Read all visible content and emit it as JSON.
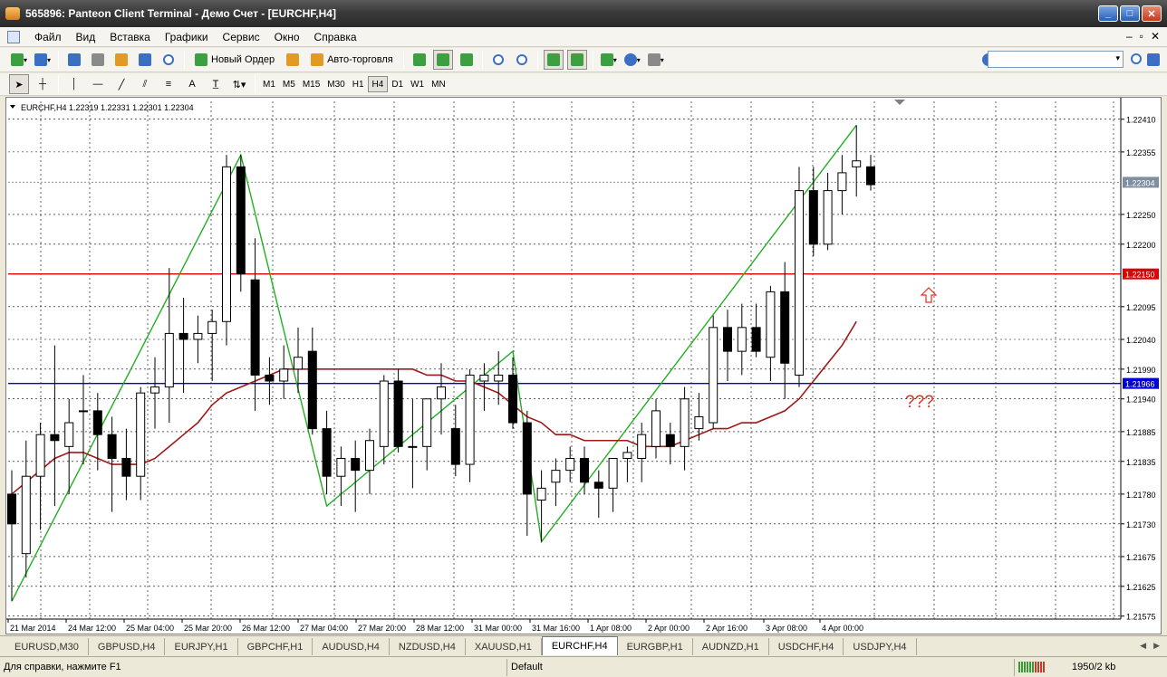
{
  "window": {
    "title": "565896: Panteon Client Terminal - Демо Счет - [EURCHF,H4]"
  },
  "menu": [
    "Файл",
    "Вид",
    "Вставка",
    "Графики",
    "Сервис",
    "Окно",
    "Справка"
  ],
  "toolbar": {
    "new_order": "Новый Ордер",
    "autotrading": "Авто-торговля"
  },
  "timeframes": [
    "M1",
    "M5",
    "M15",
    "M30",
    "H1",
    "H4",
    "D1",
    "W1",
    "MN"
  ],
  "active_timeframe": "H4",
  "draw_tools": {
    "text_tool": "A"
  },
  "search": {
    "value": ""
  },
  "chart_info": "EURCHF,H4  1.22319 1.22331 1.22301 1.22304",
  "chart_data": {
    "type": "candlestick",
    "symbol": "EURCHF",
    "timeframe": "H4",
    "ylim": [
      1.2157,
      1.2244
    ],
    "yticks": [
      "1.22410",
      "1.22355",
      "1.22304",
      "1.22250",
      "1.22200",
      "1.22150",
      "1.22095",
      "1.22040",
      "1.21990",
      "1.21966",
      "1.21940",
      "1.21885",
      "1.21835",
      "1.21780",
      "1.21730",
      "1.21675",
      "1.21625",
      "1.21575"
    ],
    "xticks": [
      "21 Mar 2014",
      "24 Mar 12:00",
      "25 Mar 04:00",
      "25 Mar 20:00",
      "26 Mar 12:00",
      "27 Mar 04:00",
      "27 Mar 20:00",
      "28 Mar 12:00",
      "31 Mar 00:00",
      "31 Mar 16:00",
      "1 Apr 08:00",
      "2 Apr 00:00",
      "2 Apr 16:00",
      "3 Apr 08:00",
      "4 Apr 00:00"
    ],
    "candles": [
      [
        1.2178,
        1.2182,
        1.216,
        1.2173
      ],
      [
        1.2168,
        1.2187,
        1.2164,
        1.2181
      ],
      [
        1.2181,
        1.219,
        1.2172,
        1.2188
      ],
      [
        1.2188,
        1.2203,
        1.2176,
        1.2187
      ],
      [
        1.2186,
        1.2194,
        1.2178,
        1.219
      ],
      [
        1.2192,
        1.2198,
        1.2183,
        1.2192
      ],
      [
        1.2192,
        1.2195,
        1.2182,
        1.2188
      ],
      [
        1.2188,
        1.2191,
        1.2175,
        1.2184
      ],
      [
        1.2184,
        1.2189,
        1.2177,
        1.2181
      ],
      [
        1.2181,
        1.2196,
        1.2177,
        1.2195
      ],
      [
        1.2195,
        1.2201,
        1.2189,
        1.2196
      ],
      [
        1.2196,
        1.2216,
        1.219,
        1.2205
      ],
      [
        1.2205,
        1.2211,
        1.2195,
        1.2204
      ],
      [
        1.2204,
        1.2208,
        1.22,
        1.2205
      ],
      [
        1.2205,
        1.2209,
        1.2197,
        1.2207
      ],
      [
        1.2207,
        1.2235,
        1.2203,
        1.2233
      ],
      [
        1.2233,
        1.2235,
        1.2212,
        1.2215
      ],
      [
        1.2214,
        1.2221,
        1.2192,
        1.2198
      ],
      [
        1.2198,
        1.2201,
        1.2193,
        1.2197
      ],
      [
        1.2197,
        1.2203,
        1.2194,
        1.2199
      ],
      [
        1.2199,
        1.2206,
        1.2195,
        1.2201
      ],
      [
        1.2202,
        1.2206,
        1.2188,
        1.2189
      ],
      [
        1.2189,
        1.2192,
        1.2178,
        1.2181
      ],
      [
        1.2181,
        1.2186,
        1.2176,
        1.2184
      ],
      [
        1.2184,
        1.2187,
        1.2175,
        1.2182
      ],
      [
        1.2182,
        1.2189,
        1.2178,
        1.2187
      ],
      [
        1.2186,
        1.2198,
        1.2183,
        1.2197
      ],
      [
        1.2197,
        1.2199,
        1.2185,
        1.2186
      ],
      [
        1.2186,
        1.2194,
        1.2179,
        1.2186
      ],
      [
        1.2186,
        1.2194,
        1.2182,
        1.2194
      ],
      [
        1.2194,
        1.22,
        1.2188,
        1.2196
      ],
      [
        1.2189,
        1.2193,
        1.2181,
        1.2183
      ],
      [
        1.2183,
        1.2199,
        1.218,
        1.2198
      ],
      [
        1.2197,
        1.22,
        1.2192,
        1.2198
      ],
      [
        1.2197,
        1.2202,
        1.2193,
        1.2198
      ],
      [
        1.2198,
        1.2201,
        1.2189,
        1.219
      ],
      [
        1.219,
        1.2192,
        1.2171,
        1.2178
      ],
      [
        1.2177,
        1.2182,
        1.217,
        1.2179
      ],
      [
        1.218,
        1.2184,
        1.2176,
        1.2182
      ],
      [
        1.2182,
        1.2186,
        1.218,
        1.2184
      ],
      [
        1.2184,
        1.2186,
        1.2178,
        1.218
      ],
      [
        1.218,
        1.2182,
        1.2174,
        1.2179
      ],
      [
        1.2179,
        1.2184,
        1.2175,
        1.2184
      ],
      [
        1.2184,
        1.2186,
        1.218,
        1.2185
      ],
      [
        1.2184,
        1.219,
        1.218,
        1.2188
      ],
      [
        1.2186,
        1.2194,
        1.2184,
        1.2192
      ],
      [
        1.2188,
        1.219,
        1.2183,
        1.2186
      ],
      [
        1.2186,
        1.2196,
        1.2182,
        1.2194
      ],
      [
        1.2189,
        1.2195,
        1.2187,
        1.2191
      ],
      [
        1.219,
        1.2208,
        1.2189,
        1.2206
      ],
      [
        1.2206,
        1.2209,
        1.2197,
        1.2202
      ],
      [
        1.2202,
        1.221,
        1.2198,
        1.2206
      ],
      [
        1.2206,
        1.221,
        1.2201,
        1.2202
      ],
      [
        1.2201,
        1.2213,
        1.2197,
        1.2212
      ],
      [
        1.2212,
        1.2217,
        1.2194,
        1.22
      ],
      [
        1.2198,
        1.2233,
        1.2196,
        1.2229
      ],
      [
        1.2229,
        1.2233,
        1.2218,
        1.222
      ],
      [
        1.222,
        1.2232,
        1.2219,
        1.2229
      ],
      [
        1.2229,
        1.2235,
        1.2225,
        1.2232
      ],
      [
        1.2233,
        1.224,
        1.2228,
        1.2234
      ],
      [
        1.2233,
        1.2235,
        1.2229,
        1.223
      ]
    ],
    "moving_average": [
      1.2178,
      1.218,
      1.2182,
      1.2184,
      1.2185,
      1.2185,
      1.2184,
      1.2183,
      1.2183,
      1.2183,
      1.2184,
      1.2186,
      1.2188,
      1.219,
      1.2193,
      1.2195,
      1.2196,
      1.2197,
      1.2198,
      1.2199,
      1.2199,
      1.2199,
      1.2199,
      1.2199,
      1.2199,
      1.2199,
      1.2199,
      1.2199,
      1.2199,
      1.2198,
      1.2198,
      1.2197,
      1.2197,
      1.2196,
      1.2195,
      1.2193,
      1.2191,
      1.219,
      1.2188,
      1.2188,
      1.2187,
      1.2187,
      1.2187,
      1.2187,
      1.2186,
      1.2186,
      1.2186,
      1.2187,
      1.2188,
      1.2189,
      1.2189,
      1.219,
      1.219,
      1.2191,
      1.2192,
      1.2194,
      1.2197,
      1.22,
      1.2203,
      1.2207
    ],
    "zigzag": [
      [
        0,
        1.216
      ],
      [
        16,
        1.2235
      ],
      [
        22,
        1.2176
      ],
      [
        35,
        1.2202
      ],
      [
        37,
        1.217
      ],
      [
        59,
        1.224
      ]
    ],
    "levels": [
      {
        "label": "1.22304",
        "value": 1.22304,
        "color": "#7f8fa0"
      },
      {
        "label": "1.22150",
        "value": 1.2215,
        "color": "#e00000"
      },
      {
        "label": "1.21966",
        "value": 1.21966,
        "color": "#0000d0"
      }
    ],
    "annotations": [
      {
        "text": "???",
        "color": "#e03020"
      }
    ]
  },
  "tabs": [
    "EURUSD,M30",
    "GBPUSD,H4",
    "EURJPY,H1",
    "GBPCHF,H1",
    "AUDUSD,H4",
    "NZDUSD,H4",
    "XAUUSD,H1",
    "EURCHF,H4",
    "EURGBP,H1",
    "AUDNZD,H1",
    "USDCHF,H4",
    "USDJPY,H4"
  ],
  "active_tab": "EURCHF,H4",
  "status": {
    "help": "Для справки, нажмите F1",
    "profile": "Default",
    "traffic": "1950/2 kb"
  },
  "colors": {
    "bull_body": "#ffffff",
    "bear_body": "#000000",
    "ma_line": "#a01818",
    "zigzag_line": "#22b022",
    "grid": "#000000"
  }
}
